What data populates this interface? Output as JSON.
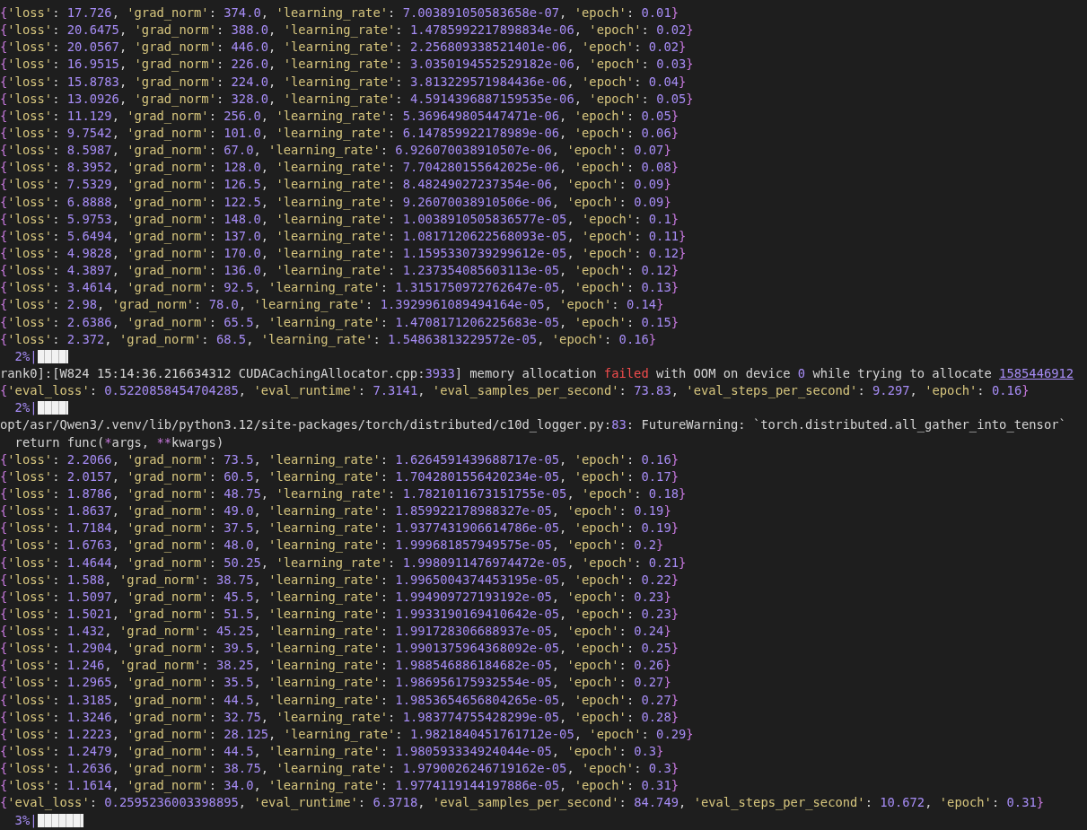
{
  "terminal": {
    "lines": [
      {
        "kind": "record",
        "open": "{",
        "close": "}",
        "separator": ": ",
        "delimiter": ", ",
        "fields": [
          {
            "key": "'loss'",
            "value": "17.726"
          },
          {
            "key": "'grad_norm'",
            "value": "374.0"
          },
          {
            "key": "'learning_rate'",
            "value": "7.003891050583658e-07"
          },
          {
            "key": "'epoch'",
            "value": "0.01"
          }
        ]
      },
      {
        "kind": "record",
        "open": "{",
        "close": "}",
        "separator": ": ",
        "delimiter": ", ",
        "fields": [
          {
            "key": "'loss'",
            "value": "20.6475"
          },
          {
            "key": "'grad_norm'",
            "value": "388.0"
          },
          {
            "key": "'learning_rate'",
            "value": "1.4785992217898834e-06"
          },
          {
            "key": "'epoch'",
            "value": "0.02"
          }
        ]
      },
      {
        "kind": "record",
        "open": "{",
        "close": "}",
        "separator": ": ",
        "delimiter": ", ",
        "fields": [
          {
            "key": "'loss'",
            "value": "20.0567"
          },
          {
            "key": "'grad_norm'",
            "value": "446.0"
          },
          {
            "key": "'learning_rate'",
            "value": "2.256809338521401e-06"
          },
          {
            "key": "'epoch'",
            "value": "0.02"
          }
        ]
      },
      {
        "kind": "record",
        "open": "{",
        "close": "}",
        "separator": ": ",
        "delimiter": ", ",
        "fields": [
          {
            "key": "'loss'",
            "value": "16.9515"
          },
          {
            "key": "'grad_norm'",
            "value": "226.0"
          },
          {
            "key": "'learning_rate'",
            "value": "3.0350194552529182e-06"
          },
          {
            "key": "'epoch'",
            "value": "0.03"
          }
        ]
      },
      {
        "kind": "record",
        "open": "{",
        "close": "}",
        "separator": ": ",
        "delimiter": ", ",
        "fields": [
          {
            "key": "'loss'",
            "value": "15.8783"
          },
          {
            "key": "'grad_norm'",
            "value": "224.0"
          },
          {
            "key": "'learning_rate'",
            "value": "3.813229571984436e-06"
          },
          {
            "key": "'epoch'",
            "value": "0.04"
          }
        ]
      },
      {
        "kind": "record",
        "open": "{",
        "close": "}",
        "separator": ": ",
        "delimiter": ", ",
        "fields": [
          {
            "key": "'loss'",
            "value": "13.0926"
          },
          {
            "key": "'grad_norm'",
            "value": "328.0"
          },
          {
            "key": "'learning_rate'",
            "value": "4.5914396887159535e-06"
          },
          {
            "key": "'epoch'",
            "value": "0.05"
          }
        ]
      },
      {
        "kind": "record",
        "open": "{",
        "close": "}",
        "separator": ": ",
        "delimiter": ", ",
        "fields": [
          {
            "key": "'loss'",
            "value": "11.129"
          },
          {
            "key": "'grad_norm'",
            "value": "256.0"
          },
          {
            "key": "'learning_rate'",
            "value": "5.369649805447471e-06"
          },
          {
            "key": "'epoch'",
            "value": "0.05"
          }
        ]
      },
      {
        "kind": "record",
        "open": "{",
        "close": "}",
        "separator": ": ",
        "delimiter": ", ",
        "fields": [
          {
            "key": "'loss'",
            "value": "9.7542"
          },
          {
            "key": "'grad_norm'",
            "value": "101.0"
          },
          {
            "key": "'learning_rate'",
            "value": "6.147859922178989e-06"
          },
          {
            "key": "'epoch'",
            "value": "0.06"
          }
        ]
      },
      {
        "kind": "record",
        "open": "{",
        "close": "}",
        "separator": ": ",
        "delimiter": ", ",
        "fields": [
          {
            "key": "'loss'",
            "value": "8.5987"
          },
          {
            "key": "'grad_norm'",
            "value": "67.0"
          },
          {
            "key": "'learning_rate'",
            "value": "6.926070038910507e-06"
          },
          {
            "key": "'epoch'",
            "value": "0.07"
          }
        ]
      },
      {
        "kind": "record",
        "open": "{",
        "close": "}",
        "separator": ": ",
        "delimiter": ", ",
        "fields": [
          {
            "key": "'loss'",
            "value": "8.3952"
          },
          {
            "key": "'grad_norm'",
            "value": "128.0"
          },
          {
            "key": "'learning_rate'",
            "value": "7.704280155642025e-06"
          },
          {
            "key": "'epoch'",
            "value": "0.08"
          }
        ]
      },
      {
        "kind": "record",
        "open": "{",
        "close": "}",
        "separator": ": ",
        "delimiter": ", ",
        "fields": [
          {
            "key": "'loss'",
            "value": "7.5329"
          },
          {
            "key": "'grad_norm'",
            "value": "126.5"
          },
          {
            "key": "'learning_rate'",
            "value": "8.48249027237354e-06"
          },
          {
            "key": "'epoch'",
            "value": "0.09"
          }
        ]
      },
      {
        "kind": "record",
        "open": "{",
        "close": "}",
        "separator": ": ",
        "delimiter": ", ",
        "fields": [
          {
            "key": "'loss'",
            "value": "6.8888"
          },
          {
            "key": "'grad_norm'",
            "value": "122.5"
          },
          {
            "key": "'learning_rate'",
            "value": "9.26070038910506e-06"
          },
          {
            "key": "'epoch'",
            "value": "0.09"
          }
        ]
      },
      {
        "kind": "record",
        "open": "{",
        "close": "}",
        "separator": ": ",
        "delimiter": ", ",
        "fields": [
          {
            "key": "'loss'",
            "value": "5.9753"
          },
          {
            "key": "'grad_norm'",
            "value": "148.0"
          },
          {
            "key": "'learning_rate'",
            "value": "1.0038910505836577e-05"
          },
          {
            "key": "'epoch'",
            "value": "0.1"
          }
        ]
      },
      {
        "kind": "record",
        "open": "{",
        "close": "}",
        "separator": ": ",
        "delimiter": ", ",
        "fields": [
          {
            "key": "'loss'",
            "value": "5.6494"
          },
          {
            "key": "'grad_norm'",
            "value": "137.0"
          },
          {
            "key": "'learning_rate'",
            "value": "1.0817120622568093e-05"
          },
          {
            "key": "'epoch'",
            "value": "0.11"
          }
        ]
      },
      {
        "kind": "record",
        "open": "{",
        "close": "}",
        "separator": ": ",
        "delimiter": ", ",
        "fields": [
          {
            "key": "'loss'",
            "value": "4.9828"
          },
          {
            "key": "'grad_norm'",
            "value": "170.0"
          },
          {
            "key": "'learning_rate'",
            "value": "1.1595330739299612e-05"
          },
          {
            "key": "'epoch'",
            "value": "0.12"
          }
        ]
      },
      {
        "kind": "record",
        "open": "{",
        "close": "}",
        "separator": ": ",
        "delimiter": ", ",
        "fields": [
          {
            "key": "'loss'",
            "value": "4.3897"
          },
          {
            "key": "'grad_norm'",
            "value": "136.0"
          },
          {
            "key": "'learning_rate'",
            "value": "1.237354085603113e-05"
          },
          {
            "key": "'epoch'",
            "value": "0.12"
          }
        ]
      },
      {
        "kind": "record",
        "open": "{",
        "close": "}",
        "separator": ": ",
        "delimiter": ", ",
        "fields": [
          {
            "key": "'loss'",
            "value": "3.4614"
          },
          {
            "key": "'grad_norm'",
            "value": "92.5"
          },
          {
            "key": "'learning_rate'",
            "value": "1.3151750972762647e-05"
          },
          {
            "key": "'epoch'",
            "value": "0.13"
          }
        ]
      },
      {
        "kind": "record",
        "open": "{",
        "close": "}",
        "separator": ": ",
        "delimiter": ", ",
        "fields": [
          {
            "key": "'loss'",
            "value": "2.98"
          },
          {
            "key": "'grad_norm'",
            "value": "78.0"
          },
          {
            "key": "'learning_rate'",
            "value": "1.3929961089494164e-05"
          },
          {
            "key": "'epoch'",
            "value": "0.14"
          }
        ]
      },
      {
        "kind": "record",
        "open": "{",
        "close": "}",
        "separator": ": ",
        "delimiter": ", ",
        "fields": [
          {
            "key": "'loss'",
            "value": "2.6386"
          },
          {
            "key": "'grad_norm'",
            "value": "65.5"
          },
          {
            "key": "'learning_rate'",
            "value": "1.4708171206225683e-05"
          },
          {
            "key": "'epoch'",
            "value": "0.15"
          }
        ]
      },
      {
        "kind": "record",
        "open": "{",
        "close": "}",
        "separator": ": ",
        "delimiter": ", ",
        "fields": [
          {
            "key": "'loss'",
            "value": "2.372"
          },
          {
            "key": "'grad_norm'",
            "value": "68.5"
          },
          {
            "key": "'learning_rate'",
            "value": "1.54863813229572e-05"
          },
          {
            "key": "'epoch'",
            "value": "0.16"
          }
        ]
      },
      {
        "kind": "progress",
        "percent": "2%",
        "bar": "|",
        "level": 0.02
      },
      {
        "kind": "text",
        "segments": [
          {
            "text": "rank0]:[W824 15:14:36.216634312 CUDACachingAllocator.cpp:",
            "kind": "plain"
          },
          {
            "text": "3933",
            "kind": "number"
          },
          {
            "text": "] memory allocation ",
            "kind": "plain"
          },
          {
            "text": "failed",
            "kind": "error"
          },
          {
            "text": " with OOM on device ",
            "kind": "plain"
          },
          {
            "text": "0",
            "kind": "number"
          },
          {
            "text": " while trying to allocate ",
            "kind": "plain"
          },
          {
            "text": "1585446912",
            "kind": "link"
          }
        ]
      },
      {
        "kind": "record",
        "open": "{",
        "close": "}",
        "separator": ": ",
        "delimiter": ", ",
        "fields": [
          {
            "key": "'eval_loss'",
            "value": "0.5220858454704285"
          },
          {
            "key": "'eval_runtime'",
            "value": "7.3141"
          },
          {
            "key": "'eval_samples_per_second'",
            "value": "73.83"
          },
          {
            "key": "'eval_steps_per_second'",
            "value": "9.297"
          },
          {
            "key": "'epoch'",
            "value": "0.16"
          }
        ]
      },
      {
        "kind": "progress",
        "percent": "2%",
        "bar": "|",
        "level": 0.02
      },
      {
        "kind": "text",
        "segments": [
          {
            "text": "opt/asr/Qwen3/.venv/lib/python3.12/site-packages/torch/distributed/c10d_logger.py:",
            "kind": "plain"
          },
          {
            "text": "83",
            "kind": "number"
          },
          {
            "text": ": FutureWarning: `torch.distributed.all_gather_into_tensor`",
            "kind": "plain"
          }
        ]
      },
      {
        "kind": "text",
        "segments": [
          {
            "text": "  return func(",
            "kind": "plain"
          },
          {
            "text": "*",
            "kind": "operator"
          },
          {
            "text": "args, ",
            "kind": "plain"
          },
          {
            "text": "**",
            "kind": "operator"
          },
          {
            "text": "kwargs)",
            "kind": "plain"
          }
        ]
      },
      {
        "kind": "record",
        "open": "{",
        "close": "}",
        "separator": ": ",
        "delimiter": ", ",
        "fields": [
          {
            "key": "'loss'",
            "value": "2.2066"
          },
          {
            "key": "'grad_norm'",
            "value": "73.5"
          },
          {
            "key": "'learning_rate'",
            "value": "1.6264591439688717e-05"
          },
          {
            "key": "'epoch'",
            "value": "0.16"
          }
        ]
      },
      {
        "kind": "record",
        "open": "{",
        "close": "}",
        "separator": ": ",
        "delimiter": ", ",
        "fields": [
          {
            "key": "'loss'",
            "value": "2.0157"
          },
          {
            "key": "'grad_norm'",
            "value": "60.5"
          },
          {
            "key": "'learning_rate'",
            "value": "1.7042801556420234e-05"
          },
          {
            "key": "'epoch'",
            "value": "0.17"
          }
        ]
      },
      {
        "kind": "record",
        "open": "{",
        "close": "}",
        "separator": ": ",
        "delimiter": ", ",
        "fields": [
          {
            "key": "'loss'",
            "value": "1.8786"
          },
          {
            "key": "'grad_norm'",
            "value": "48.75"
          },
          {
            "key": "'learning_rate'",
            "value": "1.7821011673151755e-05"
          },
          {
            "key": "'epoch'",
            "value": "0.18"
          }
        ]
      },
      {
        "kind": "record",
        "open": "{",
        "close": "}",
        "separator": ": ",
        "delimiter": ", ",
        "fields": [
          {
            "key": "'loss'",
            "value": "1.8637"
          },
          {
            "key": "'grad_norm'",
            "value": "49.0"
          },
          {
            "key": "'learning_rate'",
            "value": "1.859922178988327e-05"
          },
          {
            "key": "'epoch'",
            "value": "0.19"
          }
        ]
      },
      {
        "kind": "record",
        "open": "{",
        "close": "}",
        "separator": ": ",
        "delimiter": ", ",
        "fields": [
          {
            "key": "'loss'",
            "value": "1.7184"
          },
          {
            "key": "'grad_norm'",
            "value": "37.5"
          },
          {
            "key": "'learning_rate'",
            "value": "1.9377431906614786e-05"
          },
          {
            "key": "'epoch'",
            "value": "0.19"
          }
        ]
      },
      {
        "kind": "record",
        "open": "{",
        "close": "}",
        "separator": ": ",
        "delimiter": ", ",
        "fields": [
          {
            "key": "'loss'",
            "value": "1.6763"
          },
          {
            "key": "'grad_norm'",
            "value": "48.0"
          },
          {
            "key": "'learning_rate'",
            "value": "1.999681857949575e-05"
          },
          {
            "key": "'epoch'",
            "value": "0.2"
          }
        ]
      },
      {
        "kind": "record",
        "open": "{",
        "close": "}",
        "separator": ": ",
        "delimiter": ", ",
        "fields": [
          {
            "key": "'loss'",
            "value": "1.4644"
          },
          {
            "key": "'grad_norm'",
            "value": "50.25"
          },
          {
            "key": "'learning_rate'",
            "value": "1.9980911476974472e-05"
          },
          {
            "key": "'epoch'",
            "value": "0.21"
          }
        ]
      },
      {
        "kind": "record",
        "open": "{",
        "close": "}",
        "separator": ": ",
        "delimiter": ", ",
        "fields": [
          {
            "key": "'loss'",
            "value": "1.588"
          },
          {
            "key": "'grad_norm'",
            "value": "38.75"
          },
          {
            "key": "'learning_rate'",
            "value": "1.9965004374453195e-05"
          },
          {
            "key": "'epoch'",
            "value": "0.22"
          }
        ]
      },
      {
        "kind": "record",
        "open": "{",
        "close": "}",
        "separator": ": ",
        "delimiter": ", ",
        "fields": [
          {
            "key": "'loss'",
            "value": "1.5097"
          },
          {
            "key": "'grad_norm'",
            "value": "45.5"
          },
          {
            "key": "'learning_rate'",
            "value": "1.994909727193192e-05"
          },
          {
            "key": "'epoch'",
            "value": "0.23"
          }
        ]
      },
      {
        "kind": "record",
        "open": "{",
        "close": "}",
        "separator": ": ",
        "delimiter": ", ",
        "fields": [
          {
            "key": "'loss'",
            "value": "1.5021"
          },
          {
            "key": "'grad_norm'",
            "value": "51.5"
          },
          {
            "key": "'learning_rate'",
            "value": "1.9933190169410642e-05"
          },
          {
            "key": "'epoch'",
            "value": "0.23"
          }
        ]
      },
      {
        "kind": "record",
        "open": "{",
        "close": "}",
        "separator": ": ",
        "delimiter": ", ",
        "fields": [
          {
            "key": "'loss'",
            "value": "1.432"
          },
          {
            "key": "'grad_norm'",
            "value": "45.25"
          },
          {
            "key": "'learning_rate'",
            "value": "1.991728306688937e-05"
          },
          {
            "key": "'epoch'",
            "value": "0.24"
          }
        ]
      },
      {
        "kind": "record",
        "open": "{",
        "close": "}",
        "separator": ": ",
        "delimiter": ", ",
        "fields": [
          {
            "key": "'loss'",
            "value": "1.2904"
          },
          {
            "key": "'grad_norm'",
            "value": "39.5"
          },
          {
            "key": "'learning_rate'",
            "value": "1.9901375964368092e-05"
          },
          {
            "key": "'epoch'",
            "value": "0.25"
          }
        ]
      },
      {
        "kind": "record",
        "open": "{",
        "close": "}",
        "separator": ": ",
        "delimiter": ", ",
        "fields": [
          {
            "key": "'loss'",
            "value": "1.246"
          },
          {
            "key": "'grad_norm'",
            "value": "38.25"
          },
          {
            "key": "'learning_rate'",
            "value": "1.988546886184682e-05"
          },
          {
            "key": "'epoch'",
            "value": "0.26"
          }
        ]
      },
      {
        "kind": "record",
        "open": "{",
        "close": "}",
        "separator": ": ",
        "delimiter": ", ",
        "fields": [
          {
            "key": "'loss'",
            "value": "1.2965"
          },
          {
            "key": "'grad_norm'",
            "value": "35.5"
          },
          {
            "key": "'learning_rate'",
            "value": "1.986956175932554e-05"
          },
          {
            "key": "'epoch'",
            "value": "0.27"
          }
        ]
      },
      {
        "kind": "record",
        "open": "{",
        "close": "}",
        "separator": ": ",
        "delimiter": ", ",
        "fields": [
          {
            "key": "'loss'",
            "value": "1.3185"
          },
          {
            "key": "'grad_norm'",
            "value": "44.5"
          },
          {
            "key": "'learning_rate'",
            "value": "1.9853654656804265e-05"
          },
          {
            "key": "'epoch'",
            "value": "0.27"
          }
        ]
      },
      {
        "kind": "record",
        "open": "{",
        "close": "}",
        "separator": ": ",
        "delimiter": ", ",
        "fields": [
          {
            "key": "'loss'",
            "value": "1.3246"
          },
          {
            "key": "'grad_norm'",
            "value": "32.75"
          },
          {
            "key": "'learning_rate'",
            "value": "1.983774755428299e-05"
          },
          {
            "key": "'epoch'",
            "value": "0.28"
          }
        ]
      },
      {
        "kind": "record",
        "open": "{",
        "close": "}",
        "separator": ": ",
        "delimiter": ", ",
        "fields": [
          {
            "key": "'loss'",
            "value": "1.2223"
          },
          {
            "key": "'grad_norm'",
            "value": "28.125"
          },
          {
            "key": "'learning_rate'",
            "value": "1.9821840451761712e-05"
          },
          {
            "key": "'epoch'",
            "value": "0.29"
          }
        ]
      },
      {
        "kind": "record",
        "open": "{",
        "close": "}",
        "separator": ": ",
        "delimiter": ", ",
        "fields": [
          {
            "key": "'loss'",
            "value": "1.2479"
          },
          {
            "key": "'grad_norm'",
            "value": "44.5"
          },
          {
            "key": "'learning_rate'",
            "value": "1.980593334924044e-05"
          },
          {
            "key": "'epoch'",
            "value": "0.3"
          }
        ]
      },
      {
        "kind": "record",
        "open": "{",
        "close": "}",
        "separator": ": ",
        "delimiter": ", ",
        "fields": [
          {
            "key": "'loss'",
            "value": "1.2636"
          },
          {
            "key": "'grad_norm'",
            "value": "38.75"
          },
          {
            "key": "'learning_rate'",
            "value": "1.9790026246719162e-05"
          },
          {
            "key": "'epoch'",
            "value": "0.3"
          }
        ]
      },
      {
        "kind": "record",
        "open": "{",
        "close": "}",
        "separator": ": ",
        "delimiter": ", ",
        "fields": [
          {
            "key": "'loss'",
            "value": "1.1614"
          },
          {
            "key": "'grad_norm'",
            "value": "34.0"
          },
          {
            "key": "'learning_rate'",
            "value": "1.9774119144197886e-05"
          },
          {
            "key": "'epoch'",
            "value": "0.31"
          }
        ]
      },
      {
        "kind": "record",
        "open": "{",
        "close": "}",
        "separator": ": ",
        "delimiter": ", ",
        "fields": [
          {
            "key": "'eval_loss'",
            "value": "0.2595236003398895"
          },
          {
            "key": "'eval_runtime'",
            "value": "6.3718"
          },
          {
            "key": "'eval_samples_per_second'",
            "value": "84.749"
          },
          {
            "key": "'eval_steps_per_second'",
            "value": "10.672"
          },
          {
            "key": "'epoch'",
            "value": "0.31"
          }
        ]
      },
      {
        "kind": "progress",
        "percent": "3%",
        "bar": "|",
        "level": 0.03
      }
    ]
  }
}
